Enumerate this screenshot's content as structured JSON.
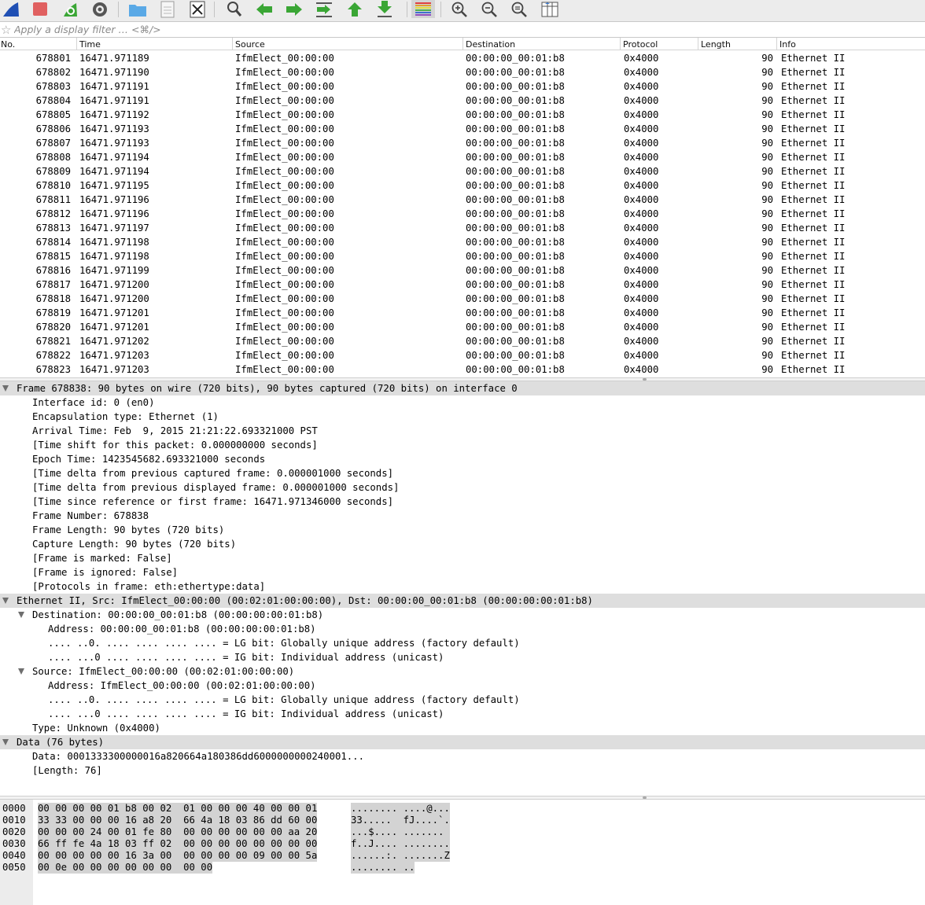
{
  "toolbar": {
    "buttons": [
      {
        "name": "start-capture-icon"
      },
      {
        "name": "stop-capture-icon"
      },
      {
        "name": "restart-capture-icon"
      },
      {
        "name": "capture-options-icon"
      },
      {
        "name": "open-file-icon"
      },
      {
        "name": "save-file-icon"
      },
      {
        "name": "close-file-icon"
      },
      {
        "name": "find-packet-icon"
      },
      {
        "name": "go-back-icon"
      },
      {
        "name": "go-forward-icon"
      },
      {
        "name": "go-to-packet-icon"
      },
      {
        "name": "go-first-packet-icon"
      },
      {
        "name": "go-last-packet-icon"
      },
      {
        "name": "colorize-icon"
      },
      {
        "name": "zoom-in-icon"
      },
      {
        "name": "zoom-out-icon"
      },
      {
        "name": "normal-size-icon"
      },
      {
        "name": "resize-columns-icon"
      }
    ],
    "colors": {
      "shark_blue": "#1f4fb4",
      "stop_red": "#e06060",
      "arrow_green": "#3aa635",
      "folder_blue": "#5aa9e6"
    }
  },
  "filter": {
    "placeholder": "Apply a display filter … <⌘/>",
    "value": ""
  },
  "packet_list": {
    "columns": [
      "No.",
      "Time",
      "Source",
      "Destination",
      "Protocol",
      "Length",
      "Info"
    ],
    "rows": [
      {
        "no": "678801",
        "time": "16471.971189",
        "src": "IfmElect_00:00:00",
        "dst": "00:00:00_00:01:b8",
        "proto": "0x4000",
        "len": "90",
        "info": "Ethernet II"
      },
      {
        "no": "678802",
        "time": "16471.971190",
        "src": "IfmElect_00:00:00",
        "dst": "00:00:00_00:01:b8",
        "proto": "0x4000",
        "len": "90",
        "info": "Ethernet II"
      },
      {
        "no": "678803",
        "time": "16471.971191",
        "src": "IfmElect_00:00:00",
        "dst": "00:00:00_00:01:b8",
        "proto": "0x4000",
        "len": "90",
        "info": "Ethernet II"
      },
      {
        "no": "678804",
        "time": "16471.971191",
        "src": "IfmElect_00:00:00",
        "dst": "00:00:00_00:01:b8",
        "proto": "0x4000",
        "len": "90",
        "info": "Ethernet II"
      },
      {
        "no": "678805",
        "time": "16471.971192",
        "src": "IfmElect_00:00:00",
        "dst": "00:00:00_00:01:b8",
        "proto": "0x4000",
        "len": "90",
        "info": "Ethernet II"
      },
      {
        "no": "678806",
        "time": "16471.971193",
        "src": "IfmElect_00:00:00",
        "dst": "00:00:00_00:01:b8",
        "proto": "0x4000",
        "len": "90",
        "info": "Ethernet II"
      },
      {
        "no": "678807",
        "time": "16471.971193",
        "src": "IfmElect_00:00:00",
        "dst": "00:00:00_00:01:b8",
        "proto": "0x4000",
        "len": "90",
        "info": "Ethernet II"
      },
      {
        "no": "678808",
        "time": "16471.971194",
        "src": "IfmElect_00:00:00",
        "dst": "00:00:00_00:01:b8",
        "proto": "0x4000",
        "len": "90",
        "info": "Ethernet II"
      },
      {
        "no": "678809",
        "time": "16471.971194",
        "src": "IfmElect_00:00:00",
        "dst": "00:00:00_00:01:b8",
        "proto": "0x4000",
        "len": "90",
        "info": "Ethernet II"
      },
      {
        "no": "678810",
        "time": "16471.971195",
        "src": "IfmElect_00:00:00",
        "dst": "00:00:00_00:01:b8",
        "proto": "0x4000",
        "len": "90",
        "info": "Ethernet II"
      },
      {
        "no": "678811",
        "time": "16471.971196",
        "src": "IfmElect_00:00:00",
        "dst": "00:00:00_00:01:b8",
        "proto": "0x4000",
        "len": "90",
        "info": "Ethernet II"
      },
      {
        "no": "678812",
        "time": "16471.971196",
        "src": "IfmElect_00:00:00",
        "dst": "00:00:00_00:01:b8",
        "proto": "0x4000",
        "len": "90",
        "info": "Ethernet II"
      },
      {
        "no": "678813",
        "time": "16471.971197",
        "src": "IfmElect_00:00:00",
        "dst": "00:00:00_00:01:b8",
        "proto": "0x4000",
        "len": "90",
        "info": "Ethernet II"
      },
      {
        "no": "678814",
        "time": "16471.971198",
        "src": "IfmElect_00:00:00",
        "dst": "00:00:00_00:01:b8",
        "proto": "0x4000",
        "len": "90",
        "info": "Ethernet II"
      },
      {
        "no": "678815",
        "time": "16471.971198",
        "src": "IfmElect_00:00:00",
        "dst": "00:00:00_00:01:b8",
        "proto": "0x4000",
        "len": "90",
        "info": "Ethernet II"
      },
      {
        "no": "678816",
        "time": "16471.971199",
        "src": "IfmElect_00:00:00",
        "dst": "00:00:00_00:01:b8",
        "proto": "0x4000",
        "len": "90",
        "info": "Ethernet II"
      },
      {
        "no": "678817",
        "time": "16471.971200",
        "src": "IfmElect_00:00:00",
        "dst": "00:00:00_00:01:b8",
        "proto": "0x4000",
        "len": "90",
        "info": "Ethernet II"
      },
      {
        "no": "678818",
        "time": "16471.971200",
        "src": "IfmElect_00:00:00",
        "dst": "00:00:00_00:01:b8",
        "proto": "0x4000",
        "len": "90",
        "info": "Ethernet II"
      },
      {
        "no": "678819",
        "time": "16471.971201",
        "src": "IfmElect_00:00:00",
        "dst": "00:00:00_00:01:b8",
        "proto": "0x4000",
        "len": "90",
        "info": "Ethernet II"
      },
      {
        "no": "678820",
        "time": "16471.971201",
        "src": "IfmElect_00:00:00",
        "dst": "00:00:00_00:01:b8",
        "proto": "0x4000",
        "len": "90",
        "info": "Ethernet II"
      },
      {
        "no": "678821",
        "time": "16471.971202",
        "src": "IfmElect_00:00:00",
        "dst": "00:00:00_00:01:b8",
        "proto": "0x4000",
        "len": "90",
        "info": "Ethernet II"
      },
      {
        "no": "678822",
        "time": "16471.971203",
        "src": "IfmElect_00:00:00",
        "dst": "00:00:00_00:01:b8",
        "proto": "0x4000",
        "len": "90",
        "info": "Ethernet II"
      },
      {
        "no": "678823",
        "time": "16471.971203",
        "src": "IfmElect_00:00:00",
        "dst": "00:00:00_00:01:b8",
        "proto": "0x4000",
        "len": "90",
        "info": "Ethernet II"
      }
    ]
  },
  "details": {
    "lines": [
      {
        "text": "Frame 678838: 90 bytes on wire (720 bits), 90 bytes captured (720 bits) on interface 0",
        "indent": 0,
        "expanded": true,
        "section": true
      },
      {
        "text": "Interface id: 0 (en0)",
        "indent": 1
      },
      {
        "text": "Encapsulation type: Ethernet (1)",
        "indent": 1
      },
      {
        "text": "Arrival Time: Feb  9, 2015 21:21:22.693321000 PST",
        "indent": 1
      },
      {
        "text": "[Time shift for this packet: 0.000000000 seconds]",
        "indent": 1
      },
      {
        "text": "Epoch Time: 1423545682.693321000 seconds",
        "indent": 1
      },
      {
        "text": "[Time delta from previous captured frame: 0.000001000 seconds]",
        "indent": 1
      },
      {
        "text": "[Time delta from previous displayed frame: 0.000001000 seconds]",
        "indent": 1
      },
      {
        "text": "[Time since reference or first frame: 16471.971346000 seconds]",
        "indent": 1
      },
      {
        "text": "Frame Number: 678838",
        "indent": 1
      },
      {
        "text": "Frame Length: 90 bytes (720 bits)",
        "indent": 1
      },
      {
        "text": "Capture Length: 90 bytes (720 bits)",
        "indent": 1
      },
      {
        "text": "[Frame is marked: False]",
        "indent": 1
      },
      {
        "text": "[Frame is ignored: False]",
        "indent": 1
      },
      {
        "text": "[Protocols in frame: eth:ethertype:data]",
        "indent": 1
      },
      {
        "text": "Ethernet II, Src: IfmElect_00:00:00 (00:02:01:00:00:00), Dst: 00:00:00_00:01:b8 (00:00:00:00:01:b8)",
        "indent": 0,
        "expanded": true,
        "section": true
      },
      {
        "text": "Destination: 00:00:00_00:01:b8 (00:00:00:00:01:b8)",
        "indent": 1,
        "expanded": true
      },
      {
        "text": "Address: 00:00:00_00:01:b8 (00:00:00:00:01:b8)",
        "indent": 2
      },
      {
        "text": ".... ..0. .... .... .... .... = LG bit: Globally unique address (factory default)",
        "indent": 2
      },
      {
        "text": ".... ...0 .... .... .... .... = IG bit: Individual address (unicast)",
        "indent": 2
      },
      {
        "text": "Source: IfmElect_00:00:00 (00:02:01:00:00:00)",
        "indent": 1,
        "expanded": true
      },
      {
        "text": "Address: IfmElect_00:00:00 (00:02:01:00:00:00)",
        "indent": 2
      },
      {
        "text": ".... ..0. .... .... .... .... = LG bit: Globally unique address (factory default)",
        "indent": 2
      },
      {
        "text": ".... ...0 .... .... .... .... = IG bit: Individual address (unicast)",
        "indent": 2
      },
      {
        "text": "Type: Unknown (0x4000)",
        "indent": 1
      },
      {
        "text": "Data (76 bytes)",
        "indent": 0,
        "expanded": true,
        "section": true
      },
      {
        "text": "Data: 0001333300000016a820664a180386dd6000000000240001...",
        "indent": 1
      },
      {
        "text": "[Length: 76]",
        "indent": 1
      }
    ]
  },
  "hex": {
    "rows": [
      {
        "offset": "0000",
        "hex": "00 00 00 00 01 b8 00 02  01 00 00 00 40 00 00 01",
        "ascii": "........ ....@..."
      },
      {
        "offset": "0010",
        "hex": "33 33 00 00 00 16 a8 20  66 4a 18 03 86 dd 60 00",
        "ascii": "33.....  fJ....`."
      },
      {
        "offset": "0020",
        "hex": "00 00 00 24 00 01 fe 80  00 00 00 00 00 00 aa 20",
        "ascii": "...$.... ....... "
      },
      {
        "offset": "0030",
        "hex": "66 ff fe 4a 18 03 ff 02  00 00 00 00 00 00 00 00",
        "ascii": "f..J.... ........"
      },
      {
        "offset": "0040",
        "hex": "00 00 00 00 00 16 3a 00  00 00 00 00 09 00 00 5a",
        "ascii": "......:. .......Z"
      },
      {
        "offset": "0050",
        "hex": "00 0e 00 00 00 00 00 00  00 00",
        "ascii": "........ .."
      }
    ]
  }
}
